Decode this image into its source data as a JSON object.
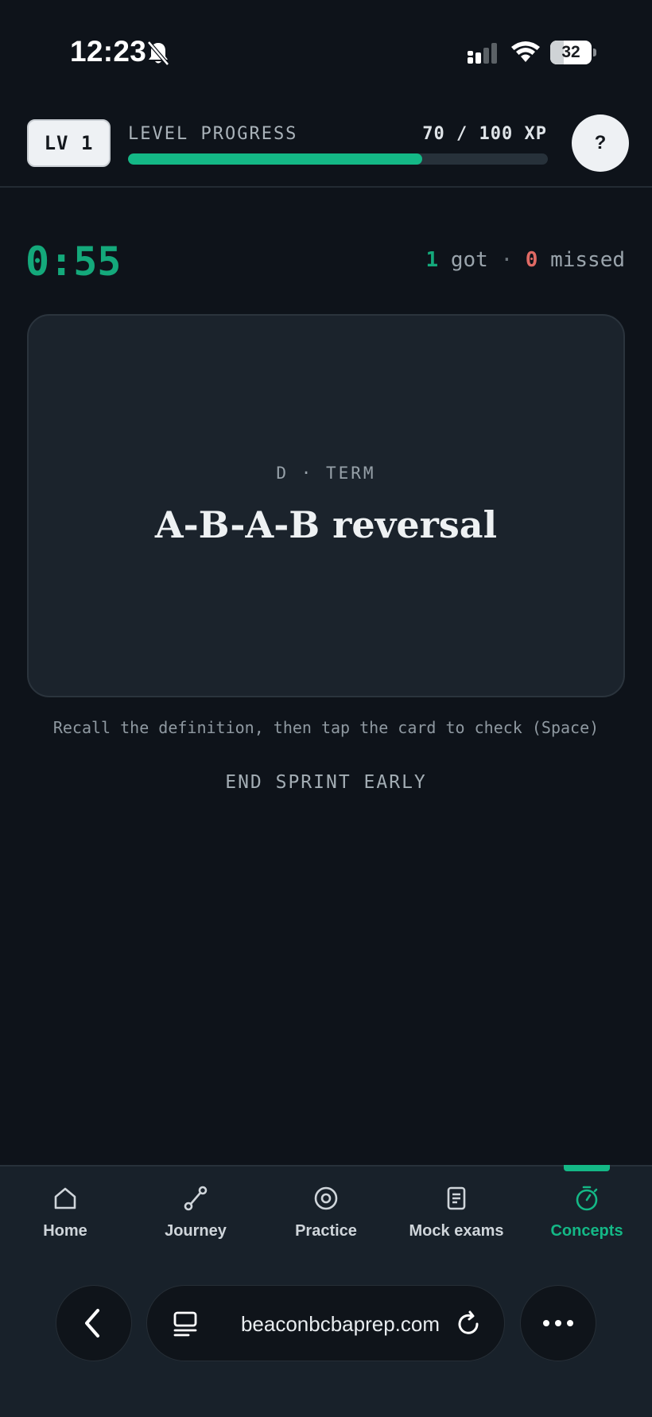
{
  "status_bar": {
    "time": "12:23",
    "battery": "32",
    "battery_level": 0.32,
    "icons": [
      "bell-slash-icon",
      "cellular-signal-icon",
      "wifi-icon",
      "battery-icon"
    ]
  },
  "header": {
    "level_badge": "LV 1",
    "progress_label": "LEVEL PROGRESS",
    "progress_text": "70 / 100 XP",
    "xp_current": 70,
    "xp_total": 100,
    "help_label": "?"
  },
  "sprint": {
    "timer": "0:55",
    "got_count": "1",
    "got_label": "got",
    "separator": "·",
    "missed_count": "0",
    "missed_label": "missed"
  },
  "card": {
    "category": "D · TERM",
    "term": "A-B-A-B reversal"
  },
  "hint": "Recall the definition, then tap the card to check (Space)",
  "end_button": "END SPRINT EARLY",
  "nav": {
    "items": [
      {
        "label": "Home",
        "icon": "home-icon",
        "active": false
      },
      {
        "label": "Journey",
        "icon": "route-icon",
        "active": false
      },
      {
        "label": "Practice",
        "icon": "target-icon",
        "active": false
      },
      {
        "label": "Mock exams",
        "icon": "document-icon",
        "active": false
      },
      {
        "label": "Concepts",
        "icon": "stopwatch-icon",
        "active": true
      }
    ]
  },
  "browser": {
    "url": "beaconbcbaprep.com"
  },
  "colors": {
    "accent": "#14b886",
    "missed": "#e06a64",
    "background": "#0e131a",
    "card": "#1b232c"
  }
}
